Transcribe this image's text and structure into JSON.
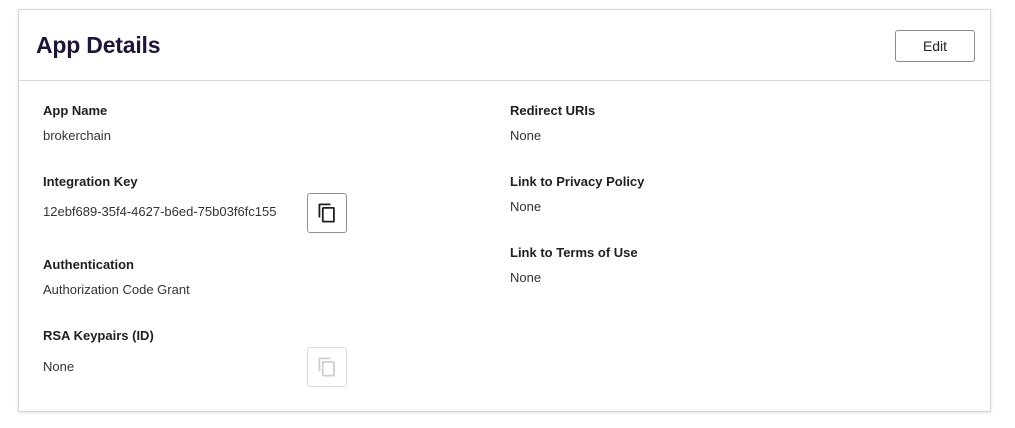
{
  "header": {
    "title": "App Details",
    "edit_label": "Edit"
  },
  "left_column": {
    "app_name": {
      "label": "App Name",
      "value": "brokerchain"
    },
    "integration_key": {
      "label": "Integration Key",
      "value": "12ebf689-35f4-4627-b6ed-75b03f6fc155",
      "copy_icon": "copy-icon"
    },
    "authentication": {
      "label": "Authentication",
      "value": "Authorization Code Grant"
    },
    "rsa_keypairs": {
      "label": "RSA Keypairs (ID)",
      "value": "None",
      "copy_icon": "copy-icon",
      "copy_disabled": true
    }
  },
  "right_column": {
    "redirect_uris": {
      "label": "Redirect URIs",
      "value": "None"
    },
    "privacy_policy": {
      "label": "Link to Privacy Policy",
      "value": "None"
    },
    "terms_of_use": {
      "label": "Link to Terms of Use",
      "value": "None"
    }
  },
  "colors": {
    "title": "#1e1538",
    "border": "#d6d6d6",
    "copy_icon": "#1f1f1f",
    "copy_icon_disabled": "#cfcfcf"
  }
}
